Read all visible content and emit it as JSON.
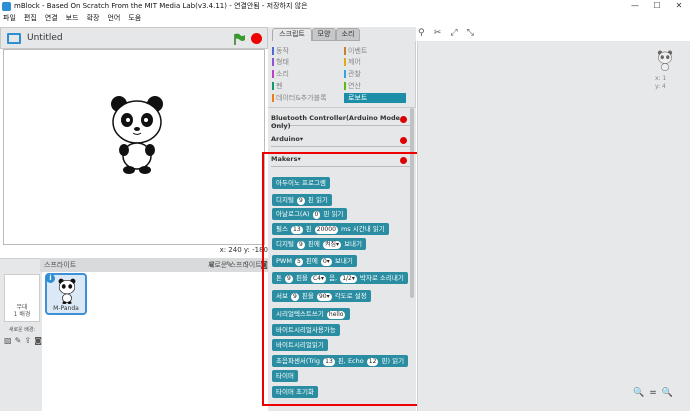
{
  "window": {
    "title": "mBlock - Based On Scratch From the MIT Media Lab(v3.4.11) - 연결안됨 - 저장하지 않은",
    "minimize": "—",
    "maximize": "☐",
    "close": "✕"
  },
  "menubar": [
    "파일",
    "편집",
    "연결",
    "보드",
    "확장",
    "언어",
    "도움"
  ],
  "stage": {
    "title": "Untitled",
    "coords": "x: 240  y: -180"
  },
  "sprites": {
    "tab_label": "스프라이트",
    "new_sprite": "새로운 스프라이트:",
    "stage_label_1": "무대",
    "stage_label_2": "1 배경",
    "new_backdrop": "새로운 배경:",
    "sprite_name": "M-Panda",
    "info": "i"
  },
  "tabs": {
    "scripts": "스크립트",
    "costumes": "모양",
    "sounds": "소리"
  },
  "categories": {
    "motion": "동작",
    "looks": "형태",
    "sound": "소리",
    "pen": "펜",
    "data": "데이터&추가블록",
    "events": "이벤트",
    "control": "제어",
    "sensing": "관찰",
    "operators": "연산",
    "robots": "로보트"
  },
  "colors": {
    "motion": "#4a6cd4",
    "looks": "#8a55d7",
    "sound": "#bb42c3",
    "pen": "#0e9a6c",
    "data": "#ee7d16",
    "events": "#c88330",
    "control": "#e1a91a",
    "sensing": "#2ca5e2",
    "operators": "#5cb712",
    "robots": "#1d8ea7",
    "block": "#2a8da1"
  },
  "sections": {
    "bluetooth": "Bluetooth Controller(Arduino Mode Only)",
    "arduino": "Arduino",
    "makers": "Makers"
  },
  "blocks": [
    {
      "parts": [
        {
          "t": "아두이노 프로그램"
        }
      ]
    },
    {
      "parts": [
        {
          "t": "디지털 "
        },
        {
          "p": "9"
        },
        {
          "t": " 핀 읽기"
        }
      ]
    },
    {
      "parts": [
        {
          "t": "아날로그(A) "
        },
        {
          "p": "0"
        },
        {
          "t": " 핀 읽기"
        }
      ]
    },
    {
      "parts": [
        {
          "t": "펄스 "
        },
        {
          "p": "13"
        },
        {
          "t": " 핀 "
        },
        {
          "p": "20000"
        },
        {
          "t": " ms 시간내 읽기"
        }
      ]
    },
    {
      "parts": [
        {
          "t": "디지털 "
        },
        {
          "p": "9"
        },
        {
          "t": " 핀에 "
        },
        {
          "p": "켜짐▾"
        },
        {
          "t": " 보내기"
        }
      ]
    },
    {
      "parts": [
        {
          "t": "PWM "
        },
        {
          "p": "5"
        },
        {
          "t": " 핀에 "
        },
        {
          "p": "0▾"
        },
        {
          "t": " 보내기"
        }
      ]
    },
    {
      "parts": [
        {
          "t": "톤 "
        },
        {
          "p": "9"
        },
        {
          "t": " 핀을 "
        },
        {
          "p": "C4▾"
        },
        {
          "t": " 음, "
        },
        {
          "p": "1/2▾"
        },
        {
          "t": " 박자로 소리내기"
        }
      ]
    },
    {
      "parts": [
        {
          "t": "서보 "
        },
        {
          "p": "9"
        },
        {
          "t": " 핀을 "
        },
        {
          "p": "90▾"
        },
        {
          "t": " 각도로 설정"
        }
      ]
    },
    {
      "parts": [
        {
          "t": "시리얼텍스트쓰기 "
        },
        {
          "p": "hello"
        }
      ]
    },
    {
      "parts": [
        {
          "t": "바이트시리얼사용가능"
        }
      ]
    },
    {
      "parts": [
        {
          "t": "바이트시리얼읽기"
        }
      ]
    },
    {
      "parts": [
        {
          "t": "초음파센서(Trig "
        },
        {
          "p": "13"
        },
        {
          "t": " 핀, Echo "
        },
        {
          "p": "12"
        },
        {
          "t": " 핀) 읽기"
        }
      ]
    },
    {
      "parts": [
        {
          "t": "타이머"
        }
      ]
    },
    {
      "parts": [
        {
          "t": "타이머 초기화"
        }
      ]
    }
  ],
  "script_area": {
    "x": "x: 1",
    "y": "y: 4"
  },
  "zoom": {
    "out": "🔍",
    "reset": "=",
    "in": "🔍"
  }
}
